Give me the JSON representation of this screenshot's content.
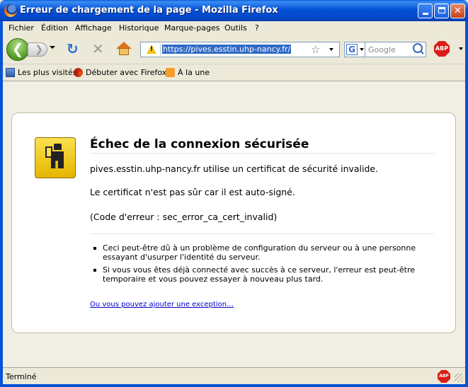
{
  "window": {
    "title": "Erreur de chargement de la page - Mozilla Firefox"
  },
  "menu": {
    "items": [
      "Fichier",
      "Édition",
      "Affichage",
      "Historique",
      "Marque-pages",
      "Outils",
      "?"
    ]
  },
  "navbar": {
    "url": "https://pives.esstin.uhp-nancy.fr/",
    "search_placeholder": "Google",
    "search_engine_letter": "G",
    "adblock_label": "ABP"
  },
  "bookmarks": {
    "items": [
      "Les plus visités",
      "Débuter avec Firefox",
      "À la une"
    ]
  },
  "error": {
    "title": "Échec de la connexion sécurisée",
    "line1": "pives.esstin.uhp-nancy.fr utilise un certificat de sécurité invalide.",
    "line2": "Le certificat n'est pas sûr car il est auto-signé.",
    "line3": "(Code d'erreur : sec_error_ca_cert_invalid)",
    "bullet1": "Ceci peut-être dû à un problème de configuration du serveur ou à une personne essayant d'usurper l'identité du serveur.",
    "bullet2": "Si vous vous êtes déjà connecté avec succès à ce serveur, l'erreur est peut-être temporaire et vous pouvez essayer à nouveau plus tard.",
    "exception_link": "Ou vous pouvez ajouter une exception…"
  },
  "status": {
    "text": "Terminé",
    "adblock_label": "ABP"
  }
}
